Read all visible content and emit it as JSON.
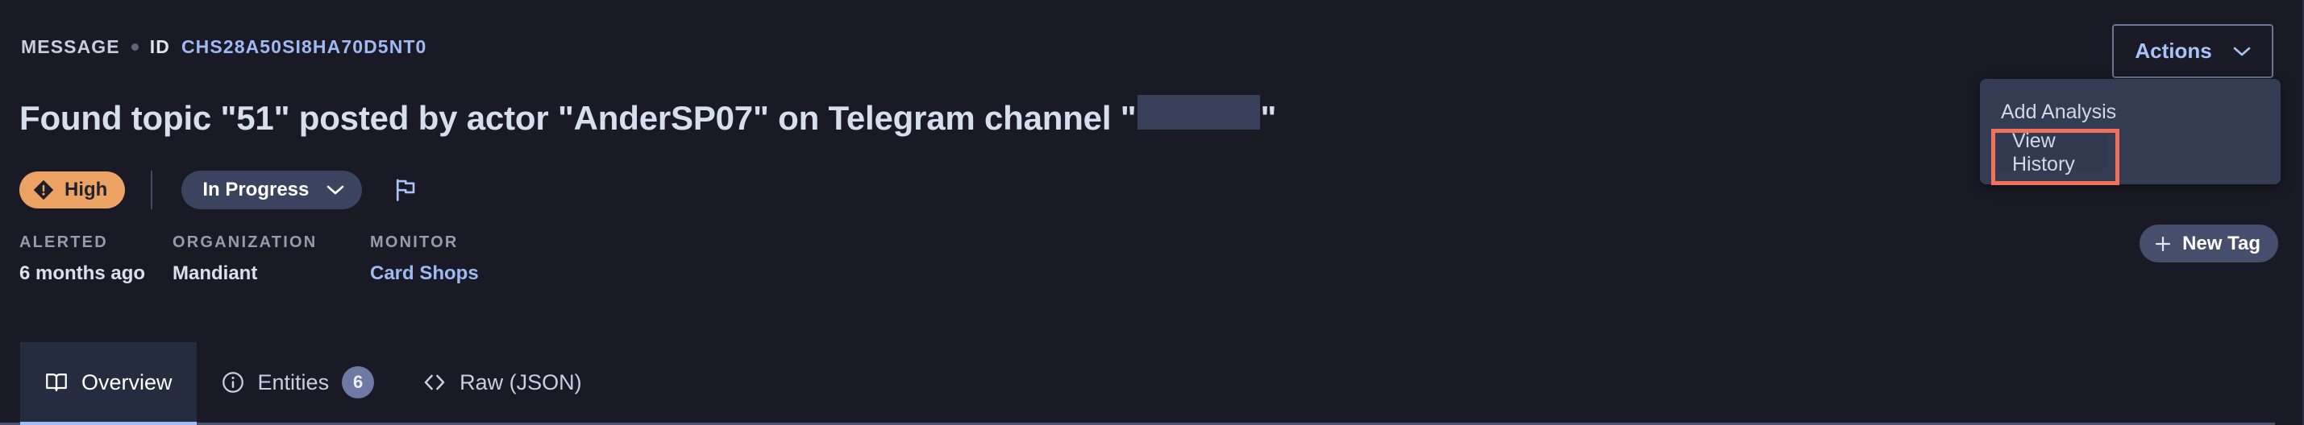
{
  "header": {
    "kind": "MESSAGE",
    "id_label": "ID",
    "id_value": "CHS28A50SI8HA70D5NT0"
  },
  "title": {
    "part1": "Found topic \"51\" posted by actor \"AnderSP07\" on Telegram channel \"",
    "part2": "\"",
    "redacted": ""
  },
  "status": {
    "severity": "High",
    "severity_color": "#eca263",
    "state": "In Progress",
    "flag_icon": "flag-icon"
  },
  "meta": [
    {
      "label": "ALERTED",
      "value": "6 months ago",
      "is_link": false
    },
    {
      "label": "ORGANIZATION",
      "value": "Mandiant",
      "is_link": false
    },
    {
      "label": "MONITOR",
      "value": "Card Shops",
      "is_link": true
    }
  ],
  "tabs": [
    {
      "label": "Overview",
      "icon": "book-icon",
      "active": true,
      "count": null
    },
    {
      "label": "Entities",
      "icon": "info-icon",
      "active": false,
      "count": "6"
    },
    {
      "label": "Raw (JSON)",
      "icon": "code-brackets-icon",
      "active": false,
      "count": null
    }
  ],
  "actions": {
    "button_label": "Actions",
    "menu": [
      {
        "label": "Add Analysis",
        "highlighted": false
      },
      {
        "label": "View History",
        "highlighted": true
      }
    ],
    "highlight_color": "#f4705a"
  },
  "new_tag": {
    "label": "New Tag"
  }
}
